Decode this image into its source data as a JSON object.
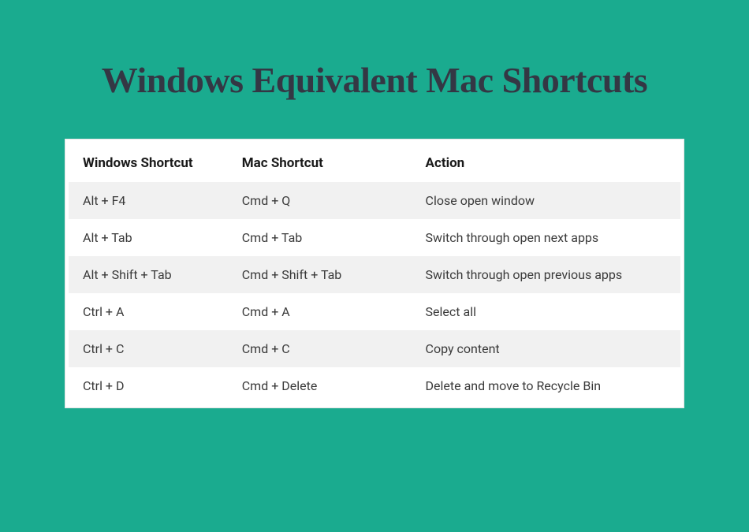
{
  "title": "Windows Equivalent Mac Shortcuts",
  "headers": {
    "windows": "Windows Shortcut",
    "mac": "Mac Shortcut",
    "action": "Action"
  },
  "rows": [
    {
      "windows": "Alt + F4",
      "mac": "Cmd + Q",
      "action": "Close open window"
    },
    {
      "windows": "Alt + Tab",
      "mac": "Cmd + Tab",
      "action": "Switch through open next apps"
    },
    {
      "windows": "Alt + Shift + Tab",
      "mac": "Cmd + Shift + Tab",
      "action": "Switch through open previous apps"
    },
    {
      "windows": "Ctrl + A",
      "mac": "Cmd + A",
      "action": "Select all"
    },
    {
      "windows": "Ctrl + C",
      "mac": "Cmd + C",
      "action": "Copy content"
    },
    {
      "windows": "Ctrl + D",
      "mac": "Cmd + Delete",
      "action": "Delete and move to Recycle Bin"
    }
  ]
}
